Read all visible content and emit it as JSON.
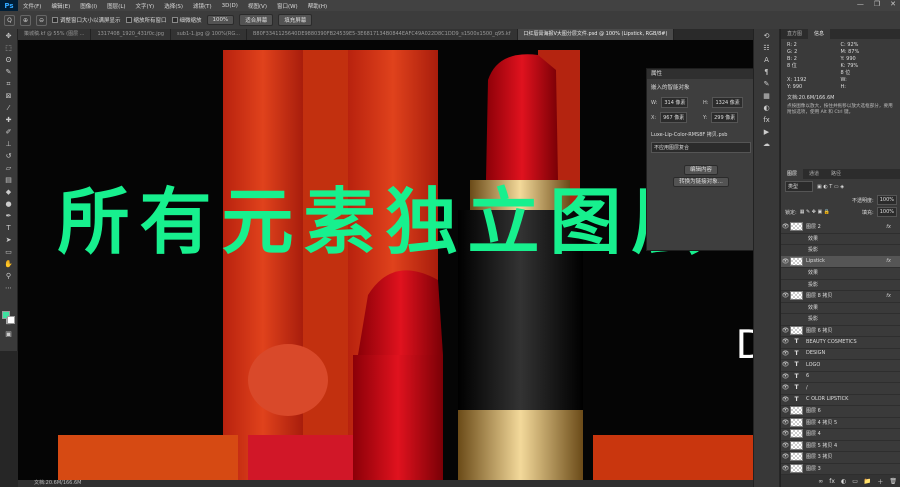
{
  "menubar": {
    "logo": "Ps",
    "items": [
      "文件(F)",
      "编辑(E)",
      "图像(I)",
      "图层(L)",
      "文字(Y)",
      "选择(S)",
      "滤镜(T)",
      "3D(D)",
      "视图(V)",
      "窗口(W)",
      "帮助(H)"
    ],
    "window_controls": [
      "—",
      "❐",
      "✕"
    ]
  },
  "options": {
    "zoom_icons": [
      "Q",
      "⊕",
      "⊖"
    ],
    "resize_windows": "调整窗口大小以满屏显示",
    "zoom_all": "缩放所有窗口",
    "scrubby_zoom": "细微缩放",
    "zoom_value": "100%",
    "fit_screen": "适合屏幕",
    "fill_screen": "填充屏幕"
  },
  "tabs": [
    {
      "label": "策城稿.kf @ 55% (图层 ...",
      "active": false
    },
    {
      "label": "1317408_1920_431f0c.jpg",
      "active": false
    },
    {
      "label": "sub1-1.jpg @ 100%(RG...",
      "active": false
    },
    {
      "label": "B80F3341125640DE9880390FB24539E5-3E6817134B0844EAFC49A022D8C1DD9_s1500x1500_q95.kf",
      "active": false
    },
    {
      "label": "口红唇膏海报V大图分层文件.psd @ 100% (Lipstick, RGB/8#)",
      "active": true
    }
  ],
  "status": "文档:20.6M/166.6M",
  "overlay_text": "所有元素独立图层",
  "canvas_letter": "D",
  "properties": {
    "title": "属性",
    "subtitle": "嵌入的智能对象",
    "w_label": "W:",
    "w_value": "314 像素",
    "h_label": "H:",
    "h_value": "1324 像素",
    "x_label": "X:",
    "x_value": "967 像素",
    "y_label": "Y:",
    "y_value": "299 像素",
    "file_name": "Luxe-Lip-Color-RMS8F 拷贝.psb",
    "layer_comp": "不应用图层复合",
    "edit_btn": "编辑内容",
    "convert_btn": "转换为链接对象..."
  },
  "info_panel": {
    "tabs": [
      "直方图",
      "信息"
    ],
    "r": "R:",
    "g": "G:",
    "b": "B:",
    "r_val": "2",
    "g_val": "2",
    "b_val": "2",
    "c": "C:",
    "m": "M:",
    "y": "Y:",
    "k": "K:",
    "c_val": "92%",
    "m_val": "87%",
    "y_val": "990",
    "k_val": "79%",
    "bit1": "8 位",
    "bit2": "8 位",
    "x_label": "X:",
    "x_val": "1192",
    "y_label": "Y:",
    "w_label": "W:",
    "h_label": "H:",
    "doc": "文档:20.6M/166.6M",
    "hint": "点按图像以放大，按住并拖移以放大选框部分，要用附加选项，使用 Alt 和 Ctrl 键。"
  },
  "layers_panel": {
    "tabs": [
      "图层",
      "通道",
      "路径"
    ],
    "filter_kind": "类型",
    "opacity_label": "不透明度:",
    "opacity_value": "100%",
    "fill_label": "填充:",
    "fill_value": "100%",
    "lock_label": "锁定:",
    "layers": [
      {
        "name": "图层 2",
        "kind": "img",
        "fx": "fx",
        "sub": false,
        "sel": false
      },
      {
        "name": "效果",
        "kind": "fx",
        "fx": "",
        "sub": true,
        "sel": false
      },
      {
        "name": "投影",
        "kind": "fx",
        "fx": "",
        "sub": true,
        "sel": false
      },
      {
        "name": "Lipstick",
        "kind": "img",
        "fx": "fx",
        "sub": false,
        "sel": true
      },
      {
        "name": "效果",
        "kind": "fx",
        "fx": "",
        "sub": true,
        "sel": false
      },
      {
        "name": "投影",
        "kind": "fx",
        "fx": "",
        "sub": true,
        "sel": false
      },
      {
        "name": "图层 8 拷贝",
        "kind": "img",
        "fx": "fx",
        "sub": false,
        "sel": false
      },
      {
        "name": "效果",
        "kind": "fx",
        "fx": "",
        "sub": true,
        "sel": false
      },
      {
        "name": "投影",
        "kind": "fx",
        "fx": "",
        "sub": true,
        "sel": false
      },
      {
        "name": "图层 6 拷贝",
        "kind": "img",
        "fx": "",
        "sub": false,
        "sel": false
      },
      {
        "name": "BEAUTY COSMETICS",
        "kind": "text",
        "fx": "",
        "sub": false,
        "sel": false
      },
      {
        "name": "DESIGN",
        "kind": "text",
        "fx": "",
        "sub": false,
        "sel": false
      },
      {
        "name": "LOGO",
        "kind": "text",
        "fx": "",
        "sub": false,
        "sel": false
      },
      {
        "name": "6",
        "kind": "text",
        "fx": "",
        "sub": false,
        "sel": false
      },
      {
        "name": "/",
        "kind": "text",
        "fx": "",
        "sub": false,
        "sel": false
      },
      {
        "name": "C OLOR LIPSTICK",
        "kind": "text",
        "fx": "",
        "sub": false,
        "sel": false
      },
      {
        "name": "图层 6",
        "kind": "img",
        "fx": "",
        "sub": false,
        "sel": false
      },
      {
        "name": "图层 4 拷贝 5",
        "kind": "img",
        "fx": "",
        "sub": false,
        "sel": false
      },
      {
        "name": "图层 4",
        "kind": "img",
        "fx": "",
        "sub": false,
        "sel": false
      },
      {
        "name": "图层 5 拷贝 4",
        "kind": "img",
        "fx": "",
        "sub": false,
        "sel": false
      },
      {
        "name": "图层 3 拷贝",
        "kind": "img",
        "fx": "",
        "sub": false,
        "sel": false
      },
      {
        "name": "图层 3",
        "kind": "img",
        "fx": "",
        "sub": false,
        "sel": false
      }
    ],
    "footer_icons": [
      "∞",
      "fx",
      "◐",
      "▭",
      "📁",
      "＋",
      "🗑"
    ]
  },
  "colors": {
    "accent": "#17f08e",
    "fg": "#3ee0a0",
    "bg": "#ffffff"
  }
}
